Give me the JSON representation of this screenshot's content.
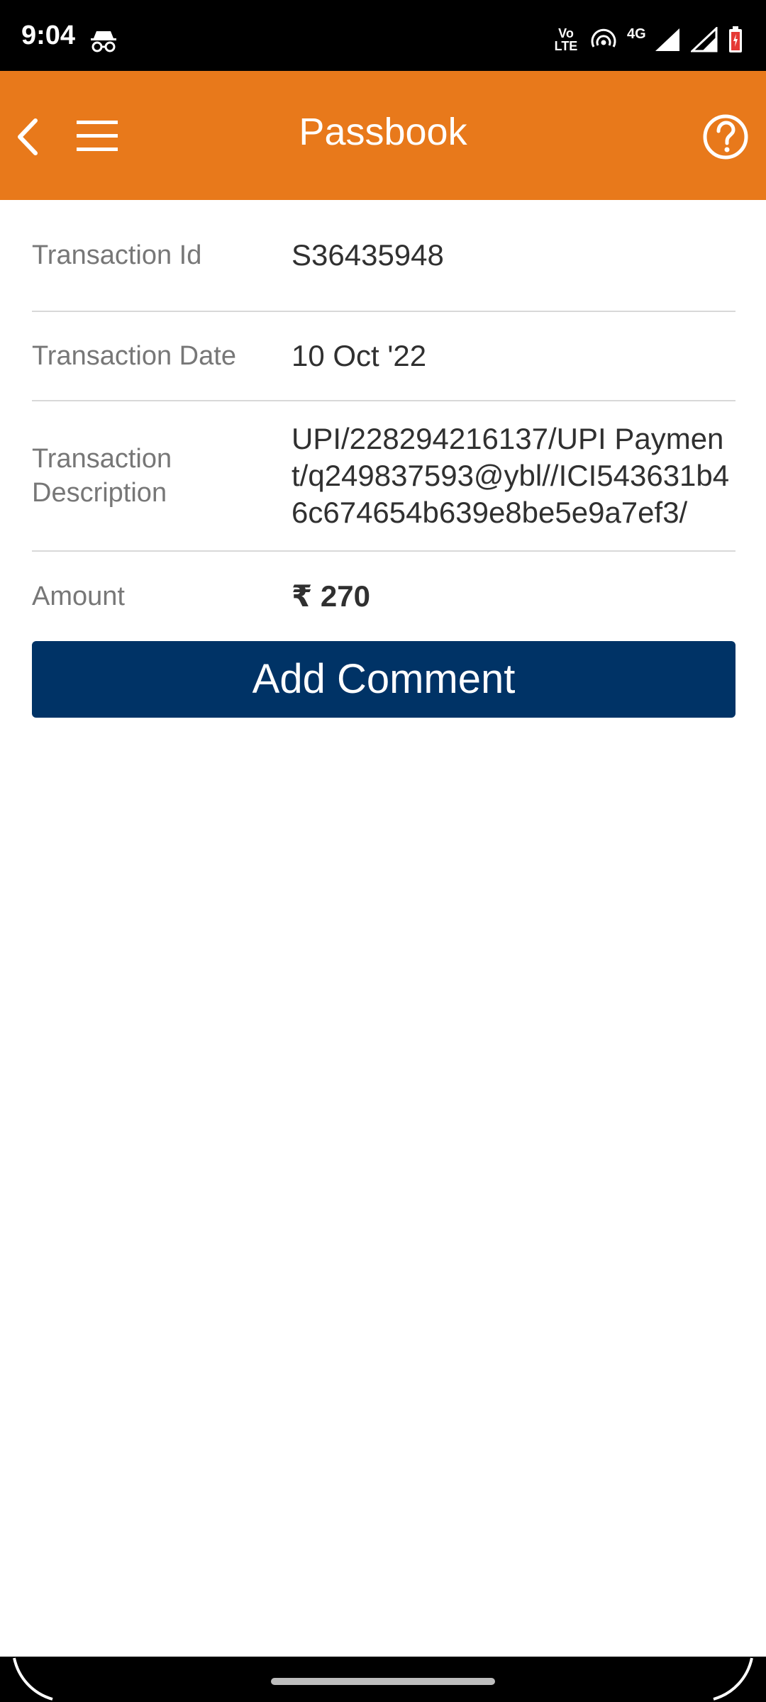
{
  "status_bar": {
    "time": "9:04",
    "network_label": "4G",
    "volte_label_top": "Vo",
    "volte_label_bottom": "LTE"
  },
  "app_bar": {
    "title": "Passbook",
    "color": "#e8791b"
  },
  "details": [
    {
      "label": "Transaction Id",
      "value": "S36435948"
    },
    {
      "label": "Transaction Date",
      "value": "10 Oct '22"
    },
    {
      "label_line1": "Transaction",
      "label_line2": "Description",
      "value": "UPI/228294216137/UPI Payment/q249837593@ybl//ICI543631b46c674654b639e8be5e9a7ef3/"
    },
    {
      "label": "Amount",
      "value": "₹ 270"
    }
  ],
  "actions": {
    "add_comment_label": "Add Comment",
    "button_color": "#003366"
  },
  "icons": {
    "back": "chevron-left-icon",
    "menu": "hamburger-menu-icon",
    "help": "help-circle-icon"
  }
}
